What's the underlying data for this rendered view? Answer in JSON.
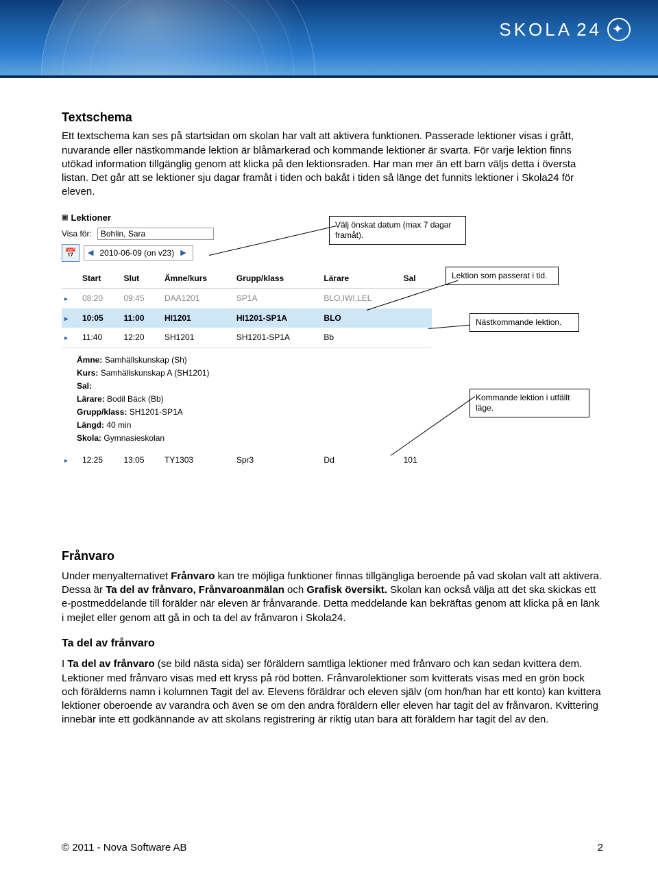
{
  "brand": {
    "name": "SKOLA",
    "suffix": "24"
  },
  "section1": {
    "title": "Textschema",
    "para": "Ett textschema kan ses på startsidan om skolan har valt att aktivera funktionen. Passerade lektioner visas i grått, nuvarande eller nästkommande lektion är blåmarkerad och kommande lektioner är svarta. För varje lektion finns utökad information tillgänglig genom att klicka på den lektionsraden. Har man mer än ett barn väljs detta i översta listan. Det går att se lektioner sju dagar framåt i tiden och bakåt i tiden så länge det funnits lektioner i Skola24 för eleven."
  },
  "widget": {
    "title": "Lektioner",
    "visa_label": "Visa för:",
    "visa_value": "Bohlin, Sara",
    "date_value": "2010-06-09 (on v23)",
    "headers": {
      "start": "Start",
      "slut": "Slut",
      "amne": "Ämne/kurs",
      "grupp": "Grupp/klass",
      "larare": "Lärare",
      "sal": "Sal"
    },
    "rows": [
      {
        "start": "08:20",
        "slut": "09:45",
        "amne": "DAA1201",
        "grupp": "SP1A",
        "larare": "BLO,IWI,LEL",
        "sal": "",
        "state": "passed"
      },
      {
        "start": "10:05",
        "slut": "11:00",
        "amne": "HI1201",
        "grupp": "HI1201-SP1A",
        "larare": "BLO",
        "sal": "",
        "state": "next"
      },
      {
        "start": "11:40",
        "slut": "12:20",
        "amne": "SH1201",
        "grupp": "SH1201-SP1A",
        "larare": "Bb",
        "sal": "",
        "state": "expanded"
      },
      {
        "start": "12:25",
        "slut": "13:05",
        "amne": "TY1303",
        "grupp": "Spr3",
        "larare": "Dd",
        "sal": "101",
        "state": "future"
      }
    ],
    "details": {
      "amne_label": "Ämne:",
      "amne": "Samhällskunskap (Sh)",
      "kurs_label": "Kurs:",
      "kurs": "Samhällskunskap A (SH1201)",
      "sal_label": "Sal:",
      "sal": "",
      "larare_label": "Lärare:",
      "larare": "Bodil Bäck (Bb)",
      "grupp_label": "Grupp/klass:",
      "grupp": "SH1201-SP1A",
      "langd_label": "Längd:",
      "langd": "40 min",
      "skola_label": "Skola:",
      "skola": "Gymnasieskolan"
    }
  },
  "callouts": {
    "c1": "Välj önskat datum (max 7 dagar framåt).",
    "c2": "Lektion som passerat i tid.",
    "c3": "Nästkommande lektion.",
    "c4": "Kommande lektion i utfällt läge."
  },
  "section2": {
    "title": "Frånvaro",
    "p1a": "Under menyalternativet ",
    "p1b": "Frånvaro",
    "p1c": " kan tre möjliga funktioner finnas tillgängliga beroende på vad skolan valt att aktivera. Dessa är ",
    "p1d": "Ta del av frånvaro, Frånvaroanmälan",
    "p1e": " och ",
    "p1f": "Grafisk översikt.",
    "p1g": " Skolan kan också välja att det ska skickas ett e-postmeddelande till förälder när eleven är frånvarande. Detta meddelande kan bekräftas genom att klicka på en länk i mejlet eller genom att gå in och ta del av frånvaron i Skola24.",
    "sub": "Ta del av frånvaro",
    "p2a": "I ",
    "p2b": "Ta del av frånvaro",
    "p2c": " (se bild nästa sida) ser föräldern samtliga lektioner med frånvaro och kan sedan kvittera dem. Lektioner med frånvaro visas med ett kryss på röd botten. Frånvarolektioner som kvitterats visas med en grön bock och förälderns namn i kolumnen Tagit del av. Elevens föräldrar och eleven själv (om hon/han har ett konto) kan kvittera lektioner oberoende av varandra och även se om den andra föräldern eller eleven har tagit del av frånvaron. Kvittering innebär inte ett godkännande av att skolans registrering är riktig utan bara att föräldern har tagit del av den."
  },
  "footer": {
    "copyright": "© 2011 - Nova Software AB",
    "page": "2"
  }
}
